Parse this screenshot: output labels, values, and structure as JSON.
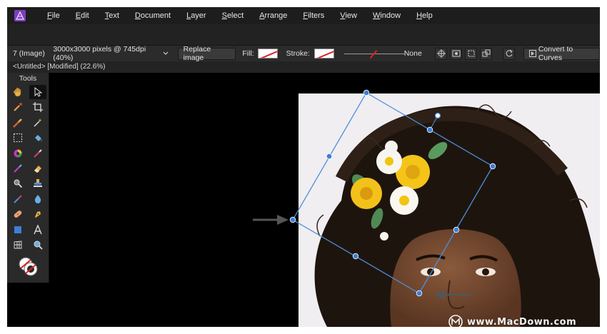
{
  "menu": {
    "items": [
      "File",
      "Edit",
      "Text",
      "Document",
      "Layer",
      "Select",
      "Arrange",
      "Filters",
      "View",
      "Window",
      "Help"
    ]
  },
  "context": {
    "layer": "7 (Image)",
    "dimensions": "3000x3000 pixels @ 745dpi (40%)",
    "replace_label": "Replace image",
    "fill_label": "Fill:",
    "stroke_label": "Stroke:",
    "stroke_width": "None",
    "convert_label": "Convert to Curves"
  },
  "document": {
    "tab_label": "<Untitled> [Modified] (22.6%)"
  },
  "tools": {
    "title": "Tools",
    "items": [
      "hand-icon",
      "move-arrow-icon",
      "color-picker-icon",
      "crop-icon",
      "paint-brush-icon",
      "magic-wand-icon",
      "marquee-icon",
      "flood-fill-icon",
      "color-wheel-icon",
      "pen-brush-icon",
      "clone-brush-icon",
      "eraser-icon",
      "dodge-icon",
      "stamp-icon",
      "smudge-icon",
      "blur-drop-icon",
      "healing-icon",
      "pen-icon",
      "rectangle-shape-icon",
      "text-icon",
      "mesh-warp-icon",
      "zoom-icon"
    ]
  },
  "colors": {
    "accent": "#4a90d9",
    "handle": "#3c7fd6",
    "canvas": "#000000"
  },
  "watermark": "www.MacDown.com"
}
